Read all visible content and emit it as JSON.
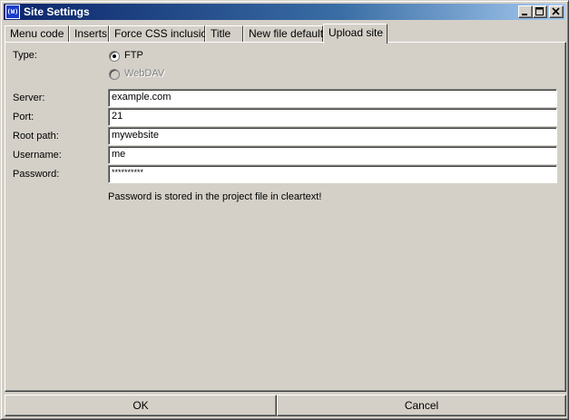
{
  "window": {
    "title": "Site Settings",
    "icon": "app-icon",
    "icon_text": "(W)"
  },
  "tabs": [
    {
      "label": "Menu code"
    },
    {
      "label": "Inserts"
    },
    {
      "label": "Force CSS inclusion"
    },
    {
      "label": "Title"
    },
    {
      "label": "New file defaults"
    },
    {
      "label": "Upload site",
      "active": true
    }
  ],
  "form": {
    "type_label": "Type:",
    "type_options": [
      {
        "label": "FTP",
        "selected": true,
        "enabled": true
      },
      {
        "label": "WebDAV",
        "selected": false,
        "enabled": false
      }
    ],
    "server_label": "Server:",
    "server_value": "example.com",
    "port_label": "Port:",
    "port_value": "21",
    "root_path_label": "Root path:",
    "root_path_value": "mywebsite",
    "username_label": "Username:",
    "username_value": "me",
    "password_label": "Password:",
    "password_value": "**********",
    "password_note": "Password is stored in the project file in cleartext!"
  },
  "buttons": {
    "ok_label": "OK",
    "cancel_label": "Cancel"
  }
}
